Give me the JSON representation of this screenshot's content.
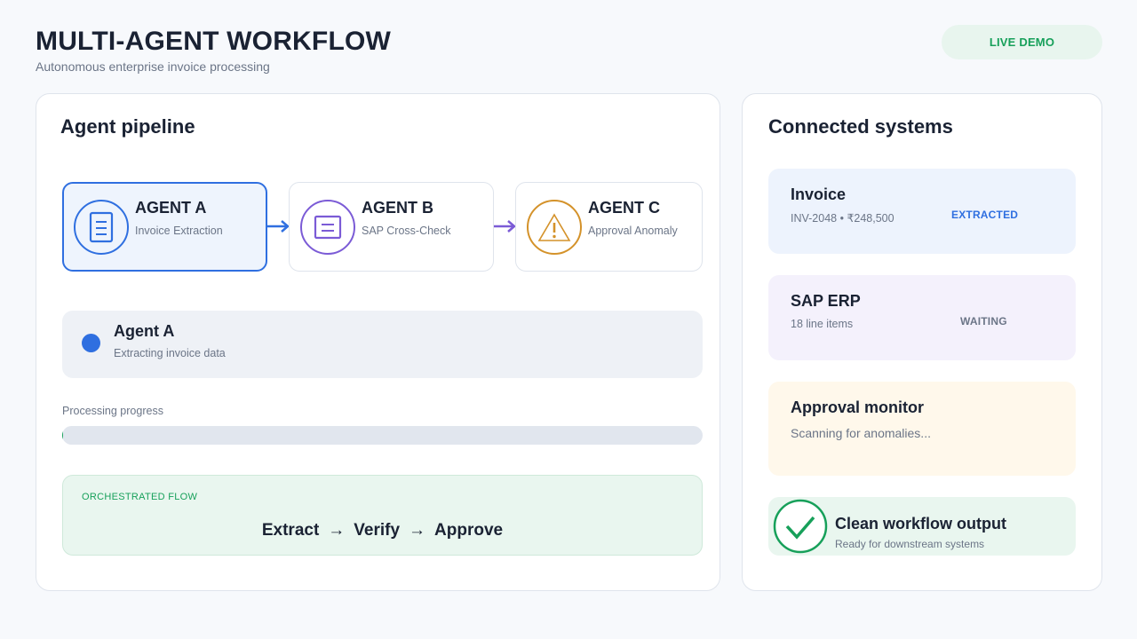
{
  "header": {
    "title": "MULTI-AGENT WORKFLOW",
    "subtitle": "Autonomous enterprise invoice processing",
    "badge": "LIVE DEMO"
  },
  "pipeline": {
    "title": "Agent pipeline",
    "agents": [
      {
        "name": "AGENT A",
        "role": "Invoice Extraction",
        "icon": "document-icon",
        "color": "#2f6fe0",
        "active": true
      },
      {
        "name": "AGENT B",
        "role": "SAP Cross-Check",
        "icon": "form-icon",
        "color": "#7b5bd6",
        "active": false
      },
      {
        "name": "AGENT C",
        "role": "Approval Anomaly",
        "icon": "warning-icon",
        "color": "#d4922a",
        "active": false
      }
    ],
    "current": {
      "name": "Agent A",
      "description": "Extracting invoice data"
    },
    "progress": {
      "label": "Processing progress",
      "value": 0.002
    },
    "flow": {
      "label": "ORCHESTRATED FLOW",
      "steps": [
        "Extract",
        "Verify",
        "Approve"
      ],
      "separator": "→"
    }
  },
  "systems": {
    "title": "Connected systems",
    "invoice": {
      "title": "Invoice",
      "detail": "INV-2048  •  ₹248,500",
      "status": "EXTRACTED"
    },
    "sap": {
      "title": "SAP ERP",
      "detail": "18 line items",
      "status": "WAITING"
    },
    "approval": {
      "title": "Approval monitor",
      "detail": "Scanning for anomalies..."
    },
    "output": {
      "title": "Clean workflow output",
      "detail": "Ready for downstream systems"
    }
  },
  "colors": {
    "accent_blue": "#2f6fe0",
    "accent_purple": "#7b5bd6",
    "accent_amber": "#d4922a",
    "accent_green": "#17a05a"
  }
}
